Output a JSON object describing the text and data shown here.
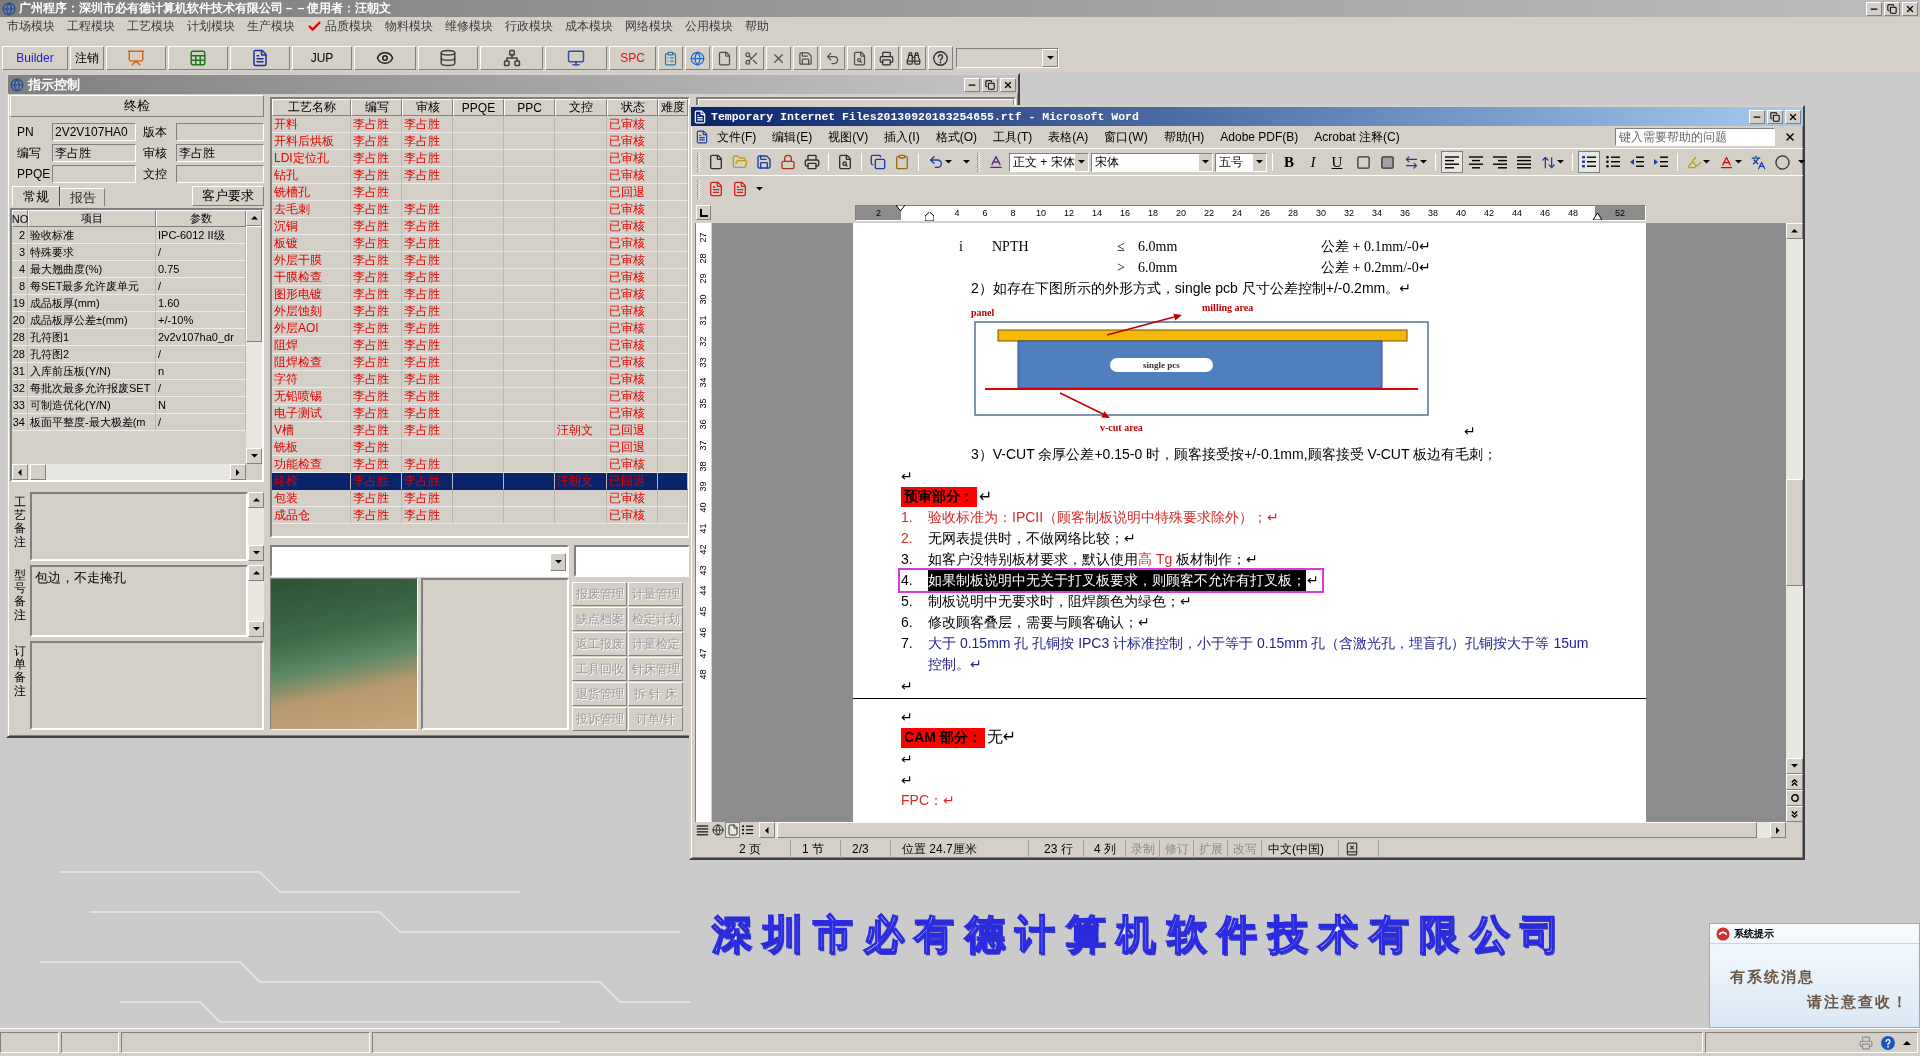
{
  "app": {
    "title": "广州程序：深圳市必有德计算机软件技术有限公司－－使用者：汪朝文"
  },
  "menu": [
    {
      "label": "市场模块",
      "checked": false
    },
    {
      "label": "工程模块",
      "checked": false
    },
    {
      "label": "工艺模块",
      "checked": false
    },
    {
      "label": "计划模块",
      "checked": false
    },
    {
      "label": "生产模块",
      "checked": false
    },
    {
      "label": "品质模块",
      "checked": true
    },
    {
      "label": "物料模块",
      "checked": false
    },
    {
      "label": "维修模块",
      "checked": false
    },
    {
      "label": "行政模块",
      "checked": false
    },
    {
      "label": "成本模块",
      "checked": false
    },
    {
      "label": "网络模块",
      "checked": false
    },
    {
      "label": "公用模块",
      "checked": false
    },
    {
      "label": "帮助",
      "checked": false
    }
  ],
  "toolbar": {
    "buttons": [
      {
        "label": "Builder",
        "color": "#1c1cc8"
      },
      {
        "label": "注销",
        "color": "#000000"
      },
      {
        "label": "JUP",
        "color": "#000000"
      },
      {
        "label": "SPC",
        "color": "#e01010"
      }
    ]
  },
  "indicator_window": {
    "title": "指示控制",
    "heading": "终检",
    "fields": [
      {
        "label": "PN",
        "value": "2V2V107HA0"
      },
      {
        "label": "版本"
      },
      {
        "label": "编写",
        "value": "李占胜"
      },
      {
        "label": "审核",
        "value": "李占胜"
      },
      {
        "label": "PPQE"
      },
      {
        "label": "文控"
      }
    ],
    "tabs": [
      {
        "label": "常规",
        "selected": true
      },
      {
        "label": "报告",
        "selected": false
      }
    ],
    "customer_button": "客户要求",
    "params": {
      "columns": [
        "NO",
        "项目",
        "参数"
      ],
      "rows": [
        {
          "no": "2",
          "item": "验收标准",
          "value": "IPC-6012 II级"
        },
        {
          "no": "3",
          "item": "特殊要求",
          "value": "/"
        },
        {
          "no": "4",
          "item": "最大翘曲度(%)",
          "value": "0.75"
        },
        {
          "no": "8",
          "item": "每SET最多允许废单元",
          "value": "/"
        },
        {
          "no": "19",
          "item": "成品板厚(mm)",
          "value": "1.60"
        },
        {
          "no": "20",
          "item": "成品板厚公差±(mm)",
          "value": "+/-10%"
        },
        {
          "no": "28",
          "item": "孔符图1",
          "value": "2v2v107ha0_dr"
        },
        {
          "no": "28",
          "item": "孔符图2",
          "value": "/"
        },
        {
          "no": "31",
          "item": "入库前压板(Y/N)",
          "value": "n"
        },
        {
          "no": "32",
          "item": "每批次最多允许报废SET",
          "value": "/"
        },
        {
          "no": "33",
          "item": "可制造优化(Y/N)",
          "value": "N"
        },
        {
          "no": "34",
          "item": "板面平整度-最大极差(m",
          "value": "/"
        }
      ]
    },
    "remarks": [
      {
        "label": "工艺备注"
      },
      {
        "label": "型号备注",
        "value": "包边，不走掩孔"
      },
      {
        "label": "订单备注"
      }
    ],
    "process_table": {
      "columns": [
        "工艺名称",
        "编写",
        "审核",
        "PPQE",
        "PPC",
        "文控",
        "状态",
        "难度"
      ],
      "rows": [
        {
          "name": "开料",
          "writer": "李占胜",
          "reviewer": "李占胜",
          "status": "已审核",
          "selected": false
        },
        {
          "name": "开料后烘板",
          "writer": "李占胜",
          "reviewer": "李占胜",
          "status": "已审核",
          "selected": false
        },
        {
          "name": "LDI定位孔",
          "writer": "李占胜",
          "reviewer": "李占胜",
          "status": "已审核",
          "selected": false
        },
        {
          "name": "钻孔",
          "writer": "李占胜",
          "reviewer": "李占胜",
          "status": "已审核",
          "selected": false
        },
        {
          "name": "铣槽孔",
          "writer": "李占胜",
          "status": "已回退",
          "selected": false
        },
        {
          "name": "去毛刺",
          "writer": "李占胜",
          "reviewer": "李占胜",
          "status": "已审核",
          "selected": false
        },
        {
          "name": "沉铜",
          "writer": "李占胜",
          "reviewer": "李占胜",
          "status": "已审核",
          "selected": false
        },
        {
          "name": "板镀",
          "writer": "李占胜",
          "reviewer": "李占胜",
          "status": "已审核",
          "selected": false
        },
        {
          "name": "外层干膜",
          "writer": "李占胜",
          "reviewer": "李占胜",
          "status": "已审核",
          "selected": false
        },
        {
          "name": "干膜检查",
          "writer": "李占胜",
          "reviewer": "李占胜",
          "status": "已审核",
          "selected": false
        },
        {
          "name": "图形电镀",
          "writer": "李占胜",
          "reviewer": "李占胜",
          "status": "已审核",
          "selected": false
        },
        {
          "name": "外层蚀刻",
          "writer": "李占胜",
          "reviewer": "李占胜",
          "status": "已审核",
          "selected": false
        },
        {
          "name": "外层AOI",
          "writer": "李占胜",
          "reviewer": "李占胜",
          "status": "已审核",
          "selected": false
        },
        {
          "name": "阻焊",
          "writer": "李占胜",
          "reviewer": "李占胜",
          "status": "已审核",
          "selected": false
        },
        {
          "name": "阻焊检查",
          "writer": "李占胜",
          "reviewer": "李占胜",
          "status": "已审核",
          "selected": false
        },
        {
          "name": "字符",
          "writer": "李占胜",
          "reviewer": "李占胜",
          "status": "已审核",
          "selected": false
        },
        {
          "name": "无铅喷锡",
          "writer": "李占胜",
          "reviewer": "李占胜",
          "status": "已审核",
          "selected": false
        },
        {
          "name": "电子测试",
          "writer": "李占胜",
          "reviewer": "李占胜",
          "status": "已审核",
          "selected": false
        },
        {
          "name": "V槽",
          "writer": "李占胜",
          "reviewer": "李占胜",
          "doc_control": "汪朝文",
          "status": "已回退",
          "selected": false
        },
        {
          "name": "铣板",
          "writer": "李占胜",
          "status": "已回退",
          "selected": false
        },
        {
          "name": "功能检查",
          "writer": "李占胜",
          "reviewer": "李占胜",
          "status": "已审核",
          "selected": false
        },
        {
          "name": "终检",
          "writer": "李占胜",
          "reviewer": "李占胜",
          "doc_control": "汪朝文",
          "status": "已回退",
          "selected": true
        },
        {
          "name": "包装",
          "writer": "李占胜",
          "reviewer": "李占胜",
          "status": "已审核",
          "selected": false
        },
        {
          "name": "成品仓",
          "writer": "李占胜",
          "reviewer": "李占胜",
          "status": "已审核",
          "selected": false
        }
      ]
    },
    "tools": [
      {
        "label": "报废管理",
        "disabled": true
      },
      {
        "label": "计量管理",
        "disabled": true
      },
      {
        "label": "缺点档案",
        "disabled": true
      },
      {
        "label": "检定计划",
        "disabled": true
      },
      {
        "label": "返工报废",
        "disabled": true
      },
      {
        "label": "计量检定",
        "disabled": true
      },
      {
        "label": "工具回收",
        "disabled": true
      },
      {
        "label": "针床管理",
        "disabled": true
      },
      {
        "label": "退货管理",
        "disabled": true
      },
      {
        "label": "拆 针 床",
        "disabled": true
      },
      {
        "label": "投诉管理",
        "disabled": true
      },
      {
        "label": "订单/针",
        "disabled": true
      }
    ]
  },
  "word": {
    "title": "Temporary Internet Files20130920183254655.rtf - Microsoft Word",
    "menu": [
      "文件(F)",
      "编辑(E)",
      "视图(V)",
      "插入(I)",
      "格式(O)",
      "工具(T)",
      "表格(A)",
      "窗口(W)",
      "帮助(H)",
      "Adobe PDF(B)",
      "Acrobat 注释(C)"
    ],
    "help": {
      "placeholder": "键入需要帮助的问题"
    },
    "style": "正文 + 宋体",
    "font": "宋体",
    "size": "五号",
    "format_letters": [
      "B",
      "I",
      "U"
    ],
    "ruler": [
      "2",
      "4",
      "6",
      "8",
      "10",
      "12",
      "14",
      "16",
      "18",
      "20",
      "22",
      "24",
      "26",
      "28",
      "30",
      "32",
      "34",
      "36",
      "38",
      "40",
      "42",
      "44",
      "46",
      "48",
      "52"
    ],
    "vertical_ruler": [
      "27",
      "28",
      "29",
      "30",
      "31",
      "32",
      "33",
      "34",
      "35",
      "36",
      "37",
      "38",
      "39",
      "40",
      "41",
      "42",
      "43",
      "44",
      "45",
      "46",
      "47",
      "48"
    ],
    "blocks": [
      {
        "kind": "tolerance",
        "mark": "i",
        "hole": "NPTH",
        "sign": "≤",
        "size": "6.0mm",
        "tolerance": "公差 + 0.1mm/-0↵"
      },
      {
        "kind": "tolerance",
        "sign": ">",
        "size": "6.0mm",
        "tolerance": "公差 + 0.2mm/-0↵"
      },
      {
        "kind": "sub_para",
        "runs": [
          {
            "text": "2）如存在下图所示的外形方式，single pcb 尺寸公差控制+/-0.2mm。↵"
          }
        ]
      },
      {
        "kind": "figure",
        "panel": "panel",
        "milling": "milling area",
        "board": "single pcs",
        "vcut": "v-cut area",
        "end": "↵"
      },
      {
        "kind": "sub_para",
        "runs": [
          {
            "text": "3）V-CUT 余厚公差+0.15-0 时，顾客接受按+/-0.1mm,顾客接受 V-CUT 板边有毛刺；"
          }
        ]
      },
      {
        "kind": "para",
        "runs": [
          {
            "text": "↵"
          }
        ]
      },
      {
        "kind": "heading",
        "text": "预审部分：",
        "after": "↵"
      },
      {
        "kind": "item",
        "marker": {
          "text": "1.",
          "color": "#d42a2a"
        },
        "runs": [
          {
            "text": "验收标准为：IPCII（顾客制板说明中特殊要求除外）；↵",
            "color": "#d42a2a"
          }
        ],
        "selected": false,
        "framed": false
      },
      {
        "kind": "item",
        "marker": {
          "text": "2.",
          "color": "#d42a2a"
        },
        "runs": [
          {
            "text": "无网表提供时，不做网络比较；↵"
          }
        ],
        "selected": false,
        "framed": false
      },
      {
        "kind": "item",
        "marker": {
          "text": "3."
        },
        "runs": [
          {
            "text": "如客户没特别板材要求，默认使用"
          },
          {
            "text": "高 Tg",
            "color": "#d42a2a"
          },
          {
            "text": " 板材制作；↵"
          }
        ],
        "selected": false,
        "framed": false
      },
      {
        "kind": "item",
        "marker": {
          "text": "4."
        },
        "runs": [
          {
            "text": "如果制板说明中无关于打叉板要求，则顾客不允许有打叉板；"
          }
        ],
        "end": "↵",
        "selected": true,
        "framed": true
      },
      {
        "kind": "item",
        "marker": {
          "text": "5."
        },
        "runs": [
          {
            "text": "制板说明中无要求时，阻焊颜色为绿色；↵"
          }
        ],
        "selected": false,
        "framed": false
      },
      {
        "kind": "item",
        "marker": {
          "text": "6."
        },
        "runs": [
          {
            "text": "修改顾客叠层，需要与顾客确认；↵"
          }
        ],
        "selected": false,
        "framed": false
      },
      {
        "kind": "item",
        "marker": {
          "text": "7."
        },
        "runs": [
          {
            "text": "大于 0.15mm 孔 孔铜按 IPC3 计标准控制，小于等于 0.15mm 孔（含激光孔，埋盲孔）孔铜按大于等 15um\n控制。↵",
            "color": "#1f1f8f"
          }
        ],
        "selected": false,
        "framed": false
      },
      {
        "kind": "para",
        "runs": [
          {
            "text": "↵"
          }
        ]
      },
      {
        "kind": "page_break"
      },
      {
        "kind": "para",
        "runs": [
          {
            "text": "↵"
          }
        ]
      },
      {
        "kind": "heading",
        "text": "CAM 部分：",
        "after": "无↵"
      },
      {
        "kind": "para",
        "runs": [
          {
            "text": "↵"
          }
        ]
      },
      {
        "kind": "para",
        "runs": [
          {
            "text": "↵"
          }
        ]
      },
      {
        "kind": "para",
        "runs": [
          {
            "text": "FPC：↵",
            "color": "#d42a2a"
          }
        ]
      }
    ],
    "status": [
      {
        "text": "2 页",
        "disabled": false
      },
      {
        "text": "1 节",
        "disabled": false
      },
      {
        "text": "2/3",
        "disabled": false
      },
      {
        "text": "位置 24.7厘米",
        "disabled": false
      },
      {
        "text": "23 行",
        "disabled": false
      },
      {
        "text": "4 列",
        "disabled": false
      },
      {
        "text": "录制",
        "disabled": true
      },
      {
        "text": "修订",
        "disabled": true
      },
      {
        "text": "扩展",
        "disabled": true
      },
      {
        "text": "改写",
        "disabled": true
      },
      {
        "text": "中文(中国)",
        "disabled": false
      }
    ]
  },
  "company_banner": "深圳市必有德计算机软件技术有限公司",
  "notice": {
    "title": "系统提示",
    "message": "有系统消息",
    "hint": "请注意查收！"
  }
}
